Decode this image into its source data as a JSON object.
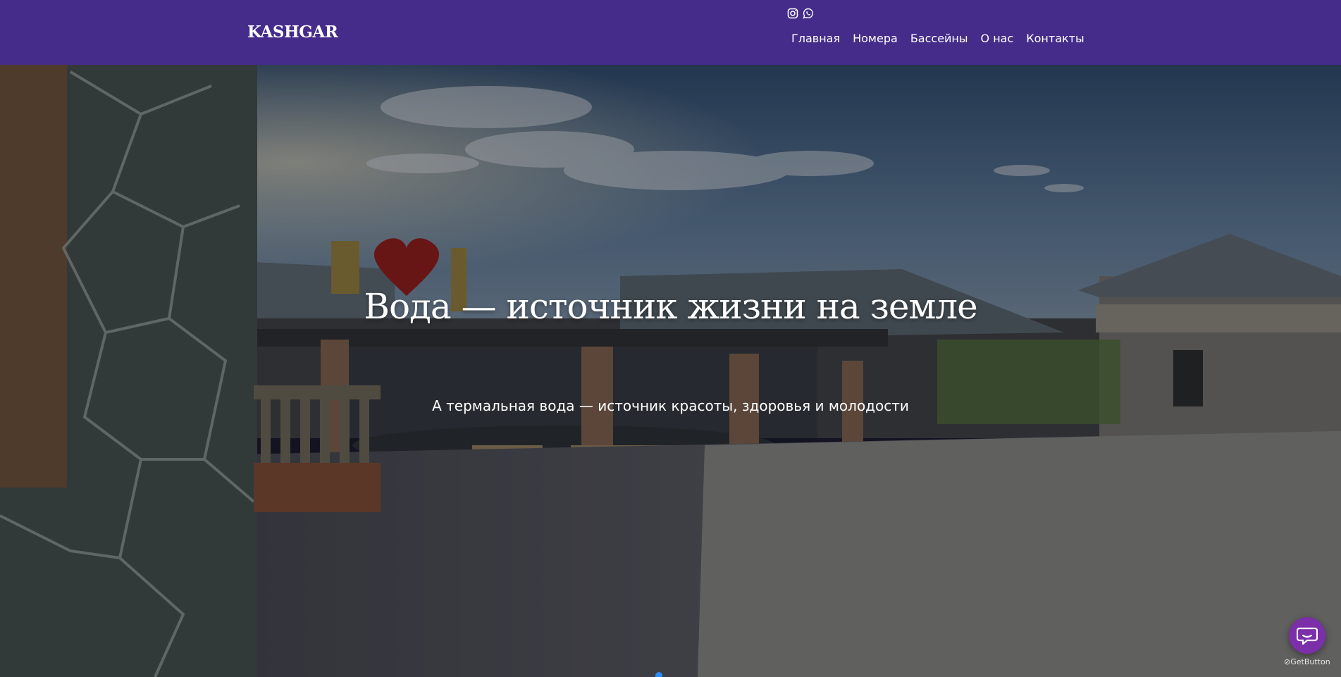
{
  "header": {
    "logo": "KASHGAR",
    "social": [
      {
        "icon": "instagram-icon"
      },
      {
        "icon": "whatsapp-icon"
      }
    ],
    "nav": [
      {
        "label": "Главная"
      },
      {
        "label": "Номера"
      },
      {
        "label": "Бассейны"
      },
      {
        "label": "О нас"
      },
      {
        "label": "Контакты"
      }
    ]
  },
  "hero": {
    "title": "Вода — источник жизни на земле",
    "subtitle": "А термальная вода — источник красоты, здоровья и молодости",
    "slides": 1,
    "active_slide": 1
  },
  "widget": {
    "chat_icon": "chat-bubble-icon",
    "brand": "GetButton"
  },
  "colors": {
    "header_bg": "#452c8a",
    "chat_btn": "#7b2fa8",
    "active_dot": "#2f8cff"
  }
}
